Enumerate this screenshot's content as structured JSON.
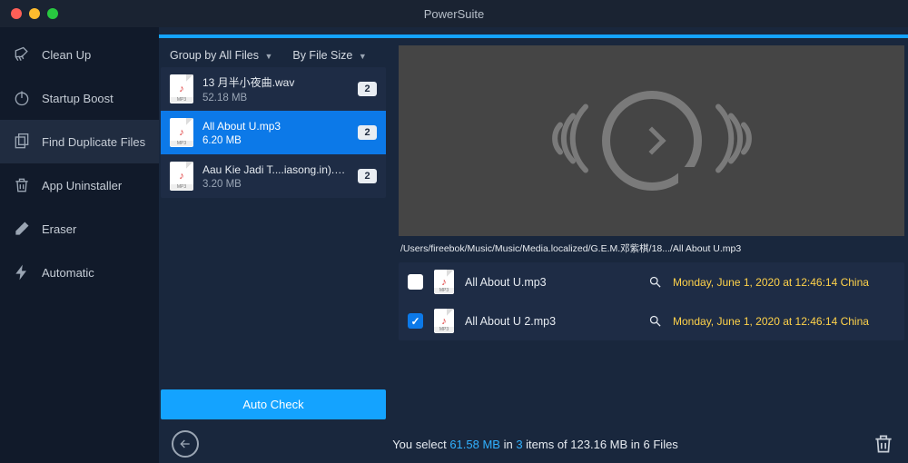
{
  "window": {
    "title": "PowerSuite"
  },
  "sidebar": {
    "items": [
      {
        "label": "Clean Up",
        "icon": "broom"
      },
      {
        "label": "Startup Boost",
        "icon": "power"
      },
      {
        "label": "Find Duplicate Files",
        "icon": "duplicate",
        "active": true
      },
      {
        "label": "App Uninstaller",
        "icon": "trash"
      },
      {
        "label": "Eraser",
        "icon": "eraser"
      },
      {
        "label": "Automatic",
        "icon": "bolt"
      }
    ]
  },
  "group_header": {
    "group_by_label": "Group by All Files",
    "sort_label": "By File Size"
  },
  "groups": [
    {
      "name": "13 月半小夜曲.wav",
      "size": "52.18 MB",
      "count": "2",
      "selected": false
    },
    {
      "name": "All About U.mp3",
      "size": "6.20 MB",
      "count": "2",
      "selected": true
    },
    {
      "name": "Aau Kie Jadi T....iasong.in).mp3",
      "size": "3.20 MB",
      "count": "2",
      "selected": false
    }
  ],
  "auto_check_label": "Auto Check",
  "preview": {
    "path": "/Users/fireebok/Music/Music/Media.localized/G.E.M.邓紫棋/18.../All About U.mp3"
  },
  "duplicates": [
    {
      "checked": false,
      "name": "All About U.mp3",
      "date": "Monday, June 1, 2020 at 12:46:14 China"
    },
    {
      "checked": true,
      "name": "All About U 2.mp3",
      "date": "Monday, June 1, 2020 at 12:46:14 China"
    }
  ],
  "footer": {
    "prefix": "You select ",
    "selected_size": "61.58 MB",
    "mid1": " in ",
    "selected_count": "3",
    "mid2": " items of ",
    "total_size": "123.16 MB",
    "mid3": " in ",
    "total_count": "6",
    "suffix": " Files"
  }
}
